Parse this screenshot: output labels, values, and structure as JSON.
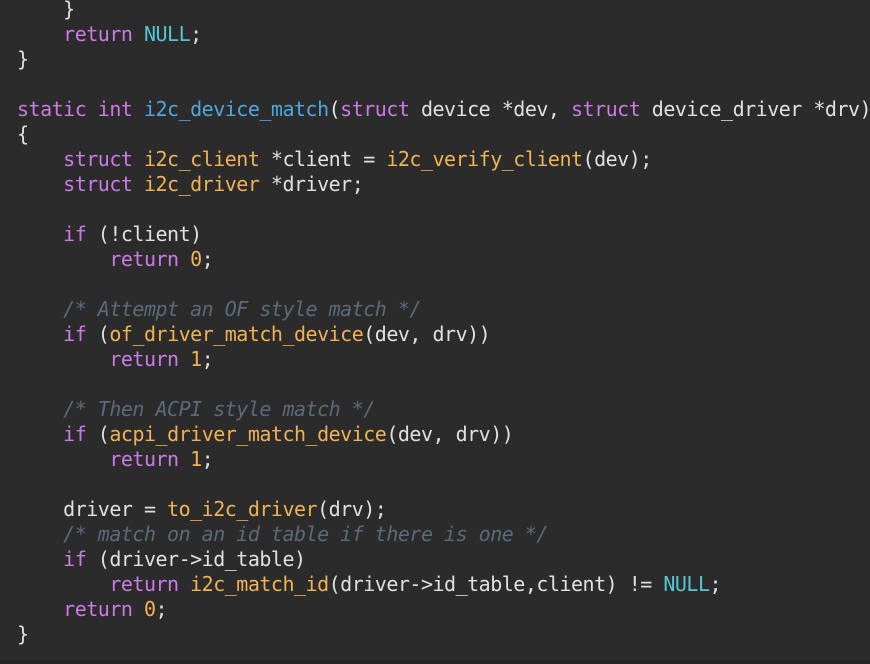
{
  "lines": [
    [
      {
        "t": "    }",
        "c": "pl"
      }
    ],
    [
      {
        "t": "    ",
        "c": "pl"
      },
      {
        "t": "return",
        "c": "kw"
      },
      {
        "t": " ",
        "c": "pl"
      },
      {
        "t": "NULL",
        "c": "nl"
      },
      {
        "t": ";",
        "c": "pl"
      }
    ],
    [
      {
        "t": "}",
        "c": "pl"
      }
    ],
    [],
    [
      {
        "t": "static",
        "c": "kw"
      },
      {
        "t": " ",
        "c": "pl"
      },
      {
        "t": "int",
        "c": "kw"
      },
      {
        "t": " ",
        "c": "pl"
      },
      {
        "t": "i2c_device_match",
        "c": "ty"
      },
      {
        "t": "(",
        "c": "pl"
      },
      {
        "t": "struct",
        "c": "kw"
      },
      {
        "t": " device *dev, ",
        "c": "pl"
      },
      {
        "t": "struct",
        "c": "kw"
      },
      {
        "t": " device_driver *drv)",
        "c": "pl"
      }
    ],
    [
      {
        "t": "{",
        "c": "pl"
      }
    ],
    [
      {
        "t": "    ",
        "c": "pl"
      },
      {
        "t": "struct",
        "c": "kw"
      },
      {
        "t": " ",
        "c": "pl"
      },
      {
        "t": "i2c_client",
        "c": "fn"
      },
      {
        "t": " *client = ",
        "c": "pl"
      },
      {
        "t": "i2c_verify_client",
        "c": "fn"
      },
      {
        "t": "(dev);",
        "c": "pl"
      }
    ],
    [
      {
        "t": "    ",
        "c": "pl"
      },
      {
        "t": "struct",
        "c": "kw"
      },
      {
        "t": " ",
        "c": "pl"
      },
      {
        "t": "i2c_driver",
        "c": "fn"
      },
      {
        "t": " *driver;",
        "c": "pl"
      }
    ],
    [],
    [
      {
        "t": "    ",
        "c": "pl"
      },
      {
        "t": "if",
        "c": "kw"
      },
      {
        "t": " (!client)",
        "c": "pl"
      }
    ],
    [
      {
        "t": "        ",
        "c": "pl"
      },
      {
        "t": "return",
        "c": "kw"
      },
      {
        "t": " ",
        "c": "pl"
      },
      {
        "t": "0",
        "c": "num"
      },
      {
        "t": ";",
        "c": "pl"
      }
    ],
    [],
    [
      {
        "t": "    ",
        "c": "pl"
      },
      {
        "t": "/* Attempt an OF style match */",
        "c": "cm"
      }
    ],
    [
      {
        "t": "    ",
        "c": "pl"
      },
      {
        "t": "if",
        "c": "kw"
      },
      {
        "t": " (",
        "c": "pl"
      },
      {
        "t": "of_driver_match_device",
        "c": "fn"
      },
      {
        "t": "(dev, drv))",
        "c": "pl"
      }
    ],
    [
      {
        "t": "        ",
        "c": "pl"
      },
      {
        "t": "return",
        "c": "kw"
      },
      {
        "t": " ",
        "c": "pl"
      },
      {
        "t": "1",
        "c": "num"
      },
      {
        "t": ";",
        "c": "pl"
      }
    ],
    [],
    [
      {
        "t": "    ",
        "c": "pl"
      },
      {
        "t": "/* Then ACPI style match */",
        "c": "cm"
      }
    ],
    [
      {
        "t": "    ",
        "c": "pl"
      },
      {
        "t": "if",
        "c": "kw"
      },
      {
        "t": " (",
        "c": "pl"
      },
      {
        "t": "acpi_driver_match_device",
        "c": "fn"
      },
      {
        "t": "(dev, drv))",
        "c": "pl"
      }
    ],
    [
      {
        "t": "        ",
        "c": "pl"
      },
      {
        "t": "return",
        "c": "kw"
      },
      {
        "t": " ",
        "c": "pl"
      },
      {
        "t": "1",
        "c": "num"
      },
      {
        "t": ";",
        "c": "pl"
      }
    ],
    [],
    [
      {
        "t": "    driver = ",
        "c": "pl"
      },
      {
        "t": "to_i2c_driver",
        "c": "fn"
      },
      {
        "t": "(drv);",
        "c": "pl"
      }
    ],
    [
      {
        "t": "    ",
        "c": "pl"
      },
      {
        "t": "/* match on an id table if there is one */",
        "c": "cm"
      }
    ],
    [
      {
        "t": "    ",
        "c": "pl"
      },
      {
        "t": "if",
        "c": "kw"
      },
      {
        "t": " (driver->id_table)",
        "c": "pl"
      }
    ],
    [
      {
        "t": "        ",
        "c": "pl"
      },
      {
        "t": "return",
        "c": "kw"
      },
      {
        "t": " ",
        "c": "pl"
      },
      {
        "t": "i2c_match_id",
        "c": "fn"
      },
      {
        "t": "(driver->id_table,client) != ",
        "c": "pl"
      },
      {
        "t": "NULL",
        "c": "nl"
      },
      {
        "t": ";",
        "c": "pl"
      }
    ],
    [
      {
        "t": "    ",
        "c": "pl"
      },
      {
        "t": "return",
        "c": "kw"
      },
      {
        "t": " ",
        "c": "pl"
      },
      {
        "t": "0",
        "c": "num"
      },
      {
        "t": ";",
        "c": "pl"
      }
    ],
    [
      {
        "t": "}",
        "c": "pl"
      }
    ]
  ]
}
